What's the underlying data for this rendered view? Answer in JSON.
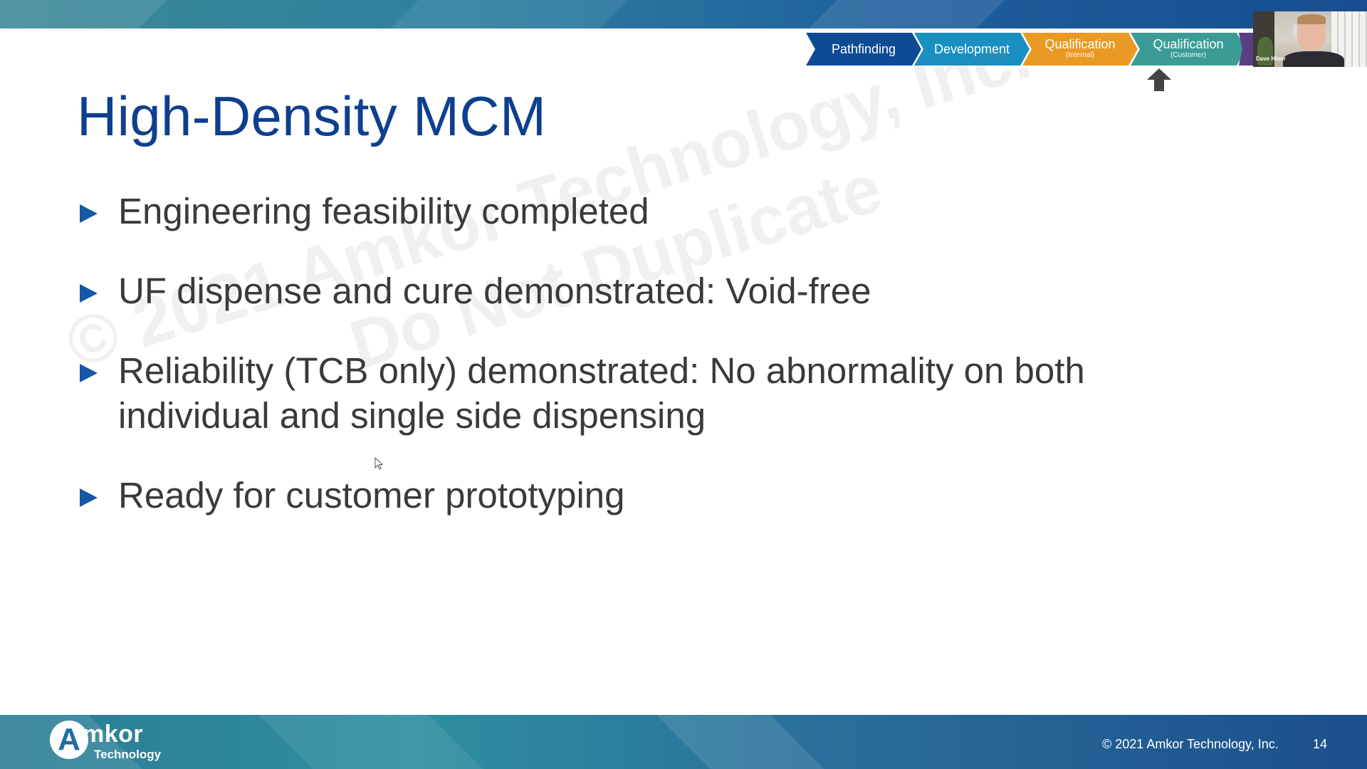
{
  "slide": {
    "title": "High-Density MCM",
    "bullets": [
      "Engineering feasibility completed",
      "UF dispense and cure demonstrated: Void-free",
      "Reliability (TCB only) demonstrated: No abnormality on both individual and single side dispensing",
      "Ready for customer prototyping"
    ],
    "watermark_line1": "© 2021 Amkor Technology, Inc.",
    "watermark_line2": "Do Not Duplicate"
  },
  "stages": [
    {
      "label": "Pathfinding",
      "sub": ""
    },
    {
      "label": "Development",
      "sub": ""
    },
    {
      "label": "Qualification",
      "sub": "(Internal)"
    },
    {
      "label": "Qualification",
      "sub": "(Customer)"
    }
  ],
  "video": {
    "participant_name": "Dave Hiner"
  },
  "footer": {
    "logo_text": "mkor",
    "logo_mark": "A",
    "logo_sub": "Technology",
    "copyright": "© 2021 Amkor Technology, Inc.",
    "page_number": "14"
  },
  "colors": {
    "title": "#0e3f8f",
    "bullet_marker": "#1558a6",
    "stage_pathfinding": "#0e4b95",
    "stage_development": "#1a8fc1",
    "stage_qual_internal": "#e99a25",
    "stage_qual_customer": "#3b9c96"
  },
  "icons": {
    "current_stage_marker": "up-arrow-icon",
    "bullet": "triangle-right-icon",
    "cursor": "mouse-pointer-icon"
  }
}
